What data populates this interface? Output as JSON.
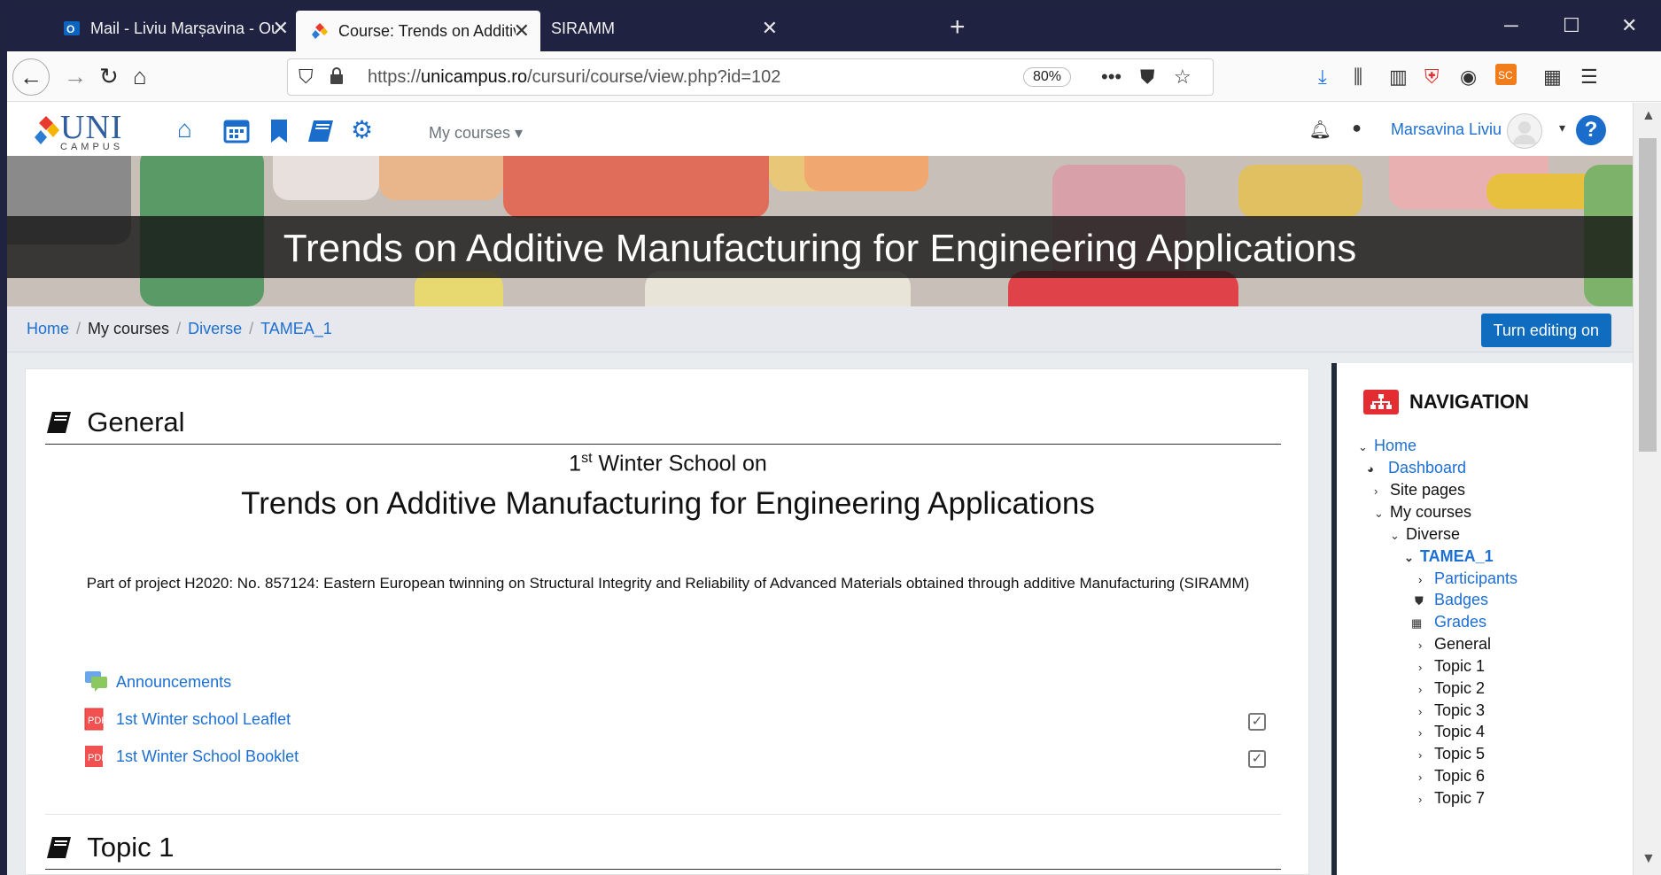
{
  "browser": {
    "tabs": [
      {
        "title": "Mail - Liviu Marșavina - Outlool",
        "icon": "outlook-icon"
      },
      {
        "title": "Course: Trends on Additive Mar",
        "icon": "unicampus-icon"
      },
      {
        "title": "SIRAMM",
        "icon": "none"
      }
    ],
    "url_prefix": "https://",
    "url_domain": "unicampus.ro",
    "url_path": "/cursuri/course/view.php?id=102",
    "zoom": "80%"
  },
  "header": {
    "logo_text": "UNI",
    "logo_sub": "CAMPUS",
    "mycourses_label": "My courses ▾",
    "username": "Marsavina Liviu"
  },
  "hero": {
    "title": "Trends on Additive Manufacturing for Engineering Applications"
  },
  "breadcrumb": {
    "items": [
      "Home",
      "My courses",
      "Diverse",
      "TAMEA_1"
    ],
    "edit_button": "Turn editing on"
  },
  "main": {
    "general_title": "General",
    "winter_ordinal": "1",
    "winter_sup": "st",
    "winter_rest": " Winter School on",
    "course_title": "Trends on Additive Manufacturing for Engineering Applications",
    "project_text": "Part of project H2020: No. 857124: Eastern European twinning on Structural Integrity and Reliability of Advanced Materials obtained through additive Manufacturing (SIRAMM)",
    "activities": [
      {
        "label": "Announcements",
        "icon": "forum-icon"
      },
      {
        "label": "1st Winter school Leaflet",
        "icon": "pdf-icon"
      },
      {
        "label": "1st Winter School Booklet",
        "icon": "pdf-icon"
      }
    ],
    "topic1_title": "Topic 1"
  },
  "navigation": {
    "title": "NAVIGATION",
    "items": [
      {
        "label": "Home"
      },
      {
        "label": "Dashboard"
      },
      {
        "label": "Site pages"
      },
      {
        "label": "My courses"
      },
      {
        "label": "Diverse"
      },
      {
        "label": "TAMEA_1"
      },
      {
        "label": "Participants"
      },
      {
        "label": "Badges"
      },
      {
        "label": "Grades"
      },
      {
        "label": "General"
      },
      {
        "label": "Topic 1"
      },
      {
        "label": "Topic 2"
      },
      {
        "label": "Topic 3"
      },
      {
        "label": "Topic 4"
      },
      {
        "label": "Topic 5"
      },
      {
        "label": "Topic 6"
      },
      {
        "label": "Topic 7"
      }
    ]
  }
}
